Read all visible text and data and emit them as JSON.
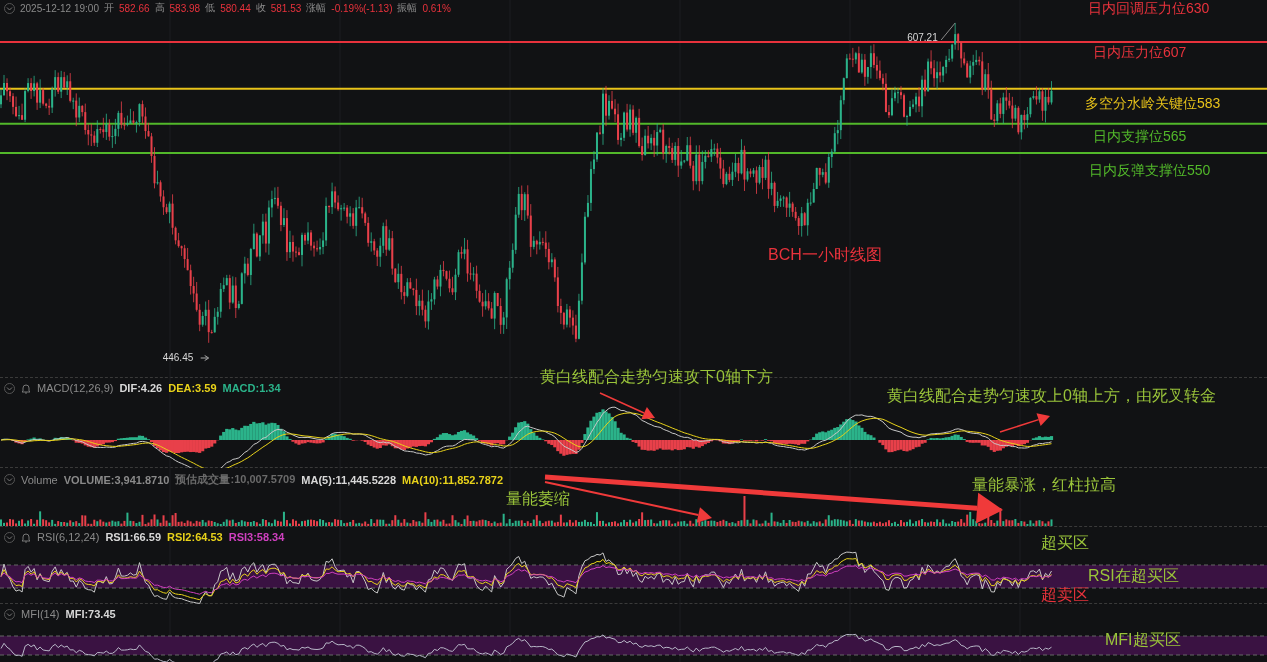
{
  "header": {
    "datetime": "2025-12-12 19:00",
    "fields": [
      {
        "label": "开",
        "value": "582.66"
      },
      {
        "label": "高",
        "value": "583.98"
      },
      {
        "label": "低",
        "value": "580.44"
      },
      {
        "label": "收",
        "value": "581.53"
      },
      {
        "label": "涨幅",
        "value": "-0.19%(-1.13)"
      },
      {
        "label": "振幅",
        "value": "0.61%"
      }
    ]
  },
  "main_chart": {
    "title": "BCH一小时线图",
    "high_marker": "607.21",
    "low_marker": "446.45",
    "levels": [
      {
        "kind": "label",
        "label": "日内回调压力位630",
        "color": "#e8323c"
      },
      {
        "kind": "line",
        "label": "日内压力位607",
        "color": "#e8323c"
      },
      {
        "kind": "line",
        "label": "多空分水岭关键位583",
        "color": "#e8c31a"
      },
      {
        "kind": "line",
        "label": "日内支撑位565",
        "color": "#52b82a"
      },
      {
        "kind": "line",
        "label": "日内反弹支撑位550",
        "color": "#52b82a"
      }
    ]
  },
  "macd": {
    "name": "MACD(12,26,9)",
    "values": [
      {
        "text": "DIF:4.26",
        "color": "#d8d8d8"
      },
      {
        "text": "DEA:3.59",
        "color": "#e8d21a"
      },
      {
        "text": "MACD:1.34",
        "color": "#2bb38a"
      }
    ],
    "annotations": [
      "黄白线配合走势匀速攻下0轴下方",
      "黄白线配合走势匀速攻上0轴上方，由死叉转金"
    ]
  },
  "volume": {
    "name": "Volume",
    "values": [
      {
        "text": "VOLUME:3,941.8710",
        "color": "#8a8a8a"
      },
      {
        "text": "预估成交量:10,007.5709",
        "color": "#6a6a6a"
      },
      {
        "text": "MA(5):11,445.5228",
        "color": "#d8d8d8"
      },
      {
        "text": "MA(10):11,852.7872",
        "color": "#e8d21a"
      }
    ],
    "annotations": [
      "量能萎缩",
      "量能暴涨，红柱拉高"
    ]
  },
  "rsi": {
    "name": "RSI(6,12,24)",
    "values": [
      {
        "text": "RSI1:66.59",
        "color": "#d8d8d8"
      },
      {
        "text": "RSI2:64.53",
        "color": "#e8d21a"
      },
      {
        "text": "RSI3:58.34",
        "color": "#d040c0"
      }
    ],
    "annotations": [
      {
        "text": "超买区",
        "color": "#9ac43a"
      },
      {
        "text": "RSI在超买区",
        "color": "#9ac43a"
      },
      {
        "text": "超卖区",
        "color": "#e8323c"
      }
    ]
  },
  "mfi": {
    "name": "MFI(14)",
    "values": [
      {
        "text": "MFI:73.45",
        "color": "#d8d8d8"
      }
    ],
    "annotations": [
      {
        "text": "MFI超买区",
        "color": "#9ac43a"
      }
    ]
  }
}
